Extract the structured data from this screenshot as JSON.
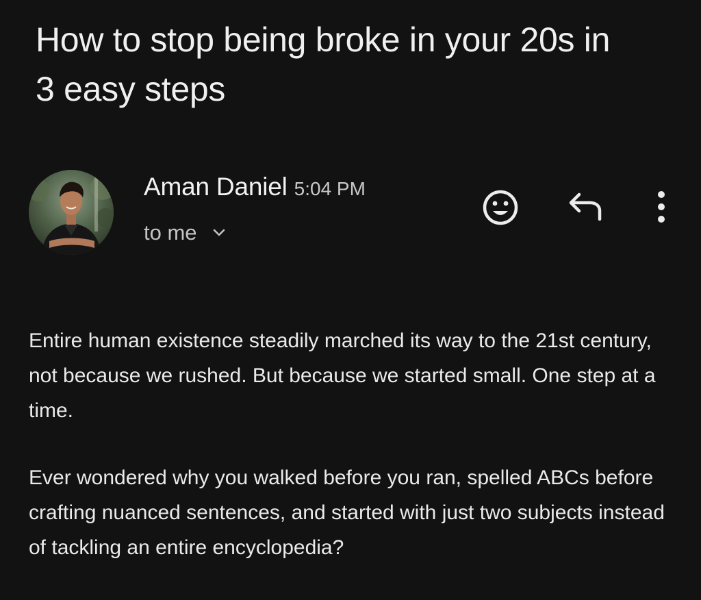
{
  "email": {
    "subject": "How to stop being broke in your 20s in 3 easy steps",
    "sender": {
      "name": "Aman Daniel",
      "time": "5:04 PM",
      "recipient_label": "to me",
      "avatar_icon": "profile-photo"
    },
    "actions": [
      {
        "name": "emoji-reaction",
        "icon": "smiley-icon"
      },
      {
        "name": "reply",
        "icon": "reply-arrow-icon"
      },
      {
        "name": "more-options",
        "icon": "vertical-dots-icon"
      }
    ],
    "body": {
      "paragraph_1": "Entire human existence steadily marched its way to the 21st century, not because we rushed. But because we started small. One step at a time.",
      "paragraph_2": "Ever wondered why you walked before you ran, spelled ABCs before crafting nuanced sentences, and started with just two subjects instead of tackling an entire encyclopedia?"
    }
  },
  "colors": {
    "background": "#121212",
    "text_primary": "#f0f0f0",
    "text_secondary": "#c4c4c4"
  }
}
